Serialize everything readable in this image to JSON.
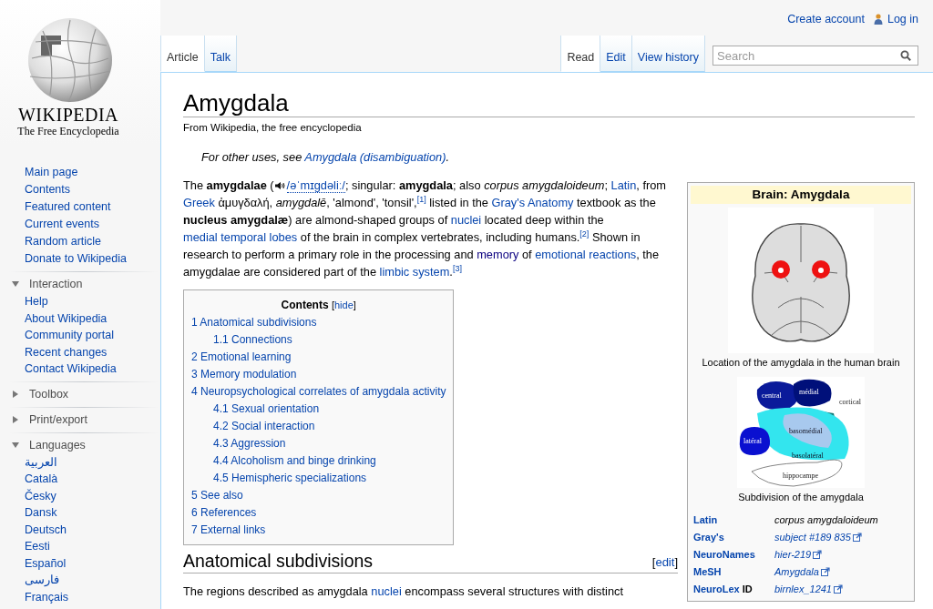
{
  "sidebar": {
    "logo": {
      "wordmark": "WIKIPEDIA",
      "tagline": "The Free Encyclopedia"
    },
    "navigation": [
      {
        "label": "Main page"
      },
      {
        "label": "Contents"
      },
      {
        "label": "Featured content"
      },
      {
        "label": "Current events"
      },
      {
        "label": "Random article"
      },
      {
        "label": "Donate to Wikipedia"
      }
    ],
    "portlets": [
      {
        "title": "Interaction",
        "expanded": true,
        "items": [
          {
            "label": "Help"
          },
          {
            "label": "About Wikipedia"
          },
          {
            "label": "Community portal"
          },
          {
            "label": "Recent changes"
          },
          {
            "label": "Contact Wikipedia"
          }
        ]
      },
      {
        "title": "Toolbox",
        "expanded": false
      },
      {
        "title": "Print/export",
        "expanded": false
      },
      {
        "title": "Languages",
        "expanded": true,
        "items": [
          {
            "label": "العربية"
          },
          {
            "label": "Català"
          },
          {
            "label": "Česky"
          },
          {
            "label": "Dansk"
          },
          {
            "label": "Deutsch"
          },
          {
            "label": "Eesti"
          },
          {
            "label": "Español"
          },
          {
            "label": "فارسی"
          },
          {
            "label": "Français"
          }
        ]
      }
    ]
  },
  "personal_tools": [
    {
      "label": "Create account",
      "icon": false
    },
    {
      "label": "Log in",
      "icon": true
    }
  ],
  "namespace_tabs": [
    {
      "label": "Article",
      "selected": true
    },
    {
      "label": "Talk",
      "selected": false
    }
  ],
  "view_tabs": [
    {
      "label": "Read",
      "selected": true
    },
    {
      "label": "Edit",
      "selected": false
    },
    {
      "label": "View history",
      "selected": false
    }
  ],
  "search": {
    "placeholder": "Search"
  },
  "article": {
    "title": "Amygdala",
    "tagline": "From Wikipedia, the free encyclopedia",
    "hatnote": [
      {
        "kind": "text",
        "text": "For other uses, see "
      },
      {
        "kind": "link",
        "text": "Amygdala (disambiguation)"
      },
      {
        "kind": "text",
        "text": "."
      }
    ],
    "intro": [
      {
        "kind": "text",
        "text": "The "
      },
      {
        "kind": "bold",
        "text": "amygdalae"
      },
      {
        "kind": "text",
        "text": " ("
      },
      {
        "kind": "audio"
      },
      {
        "kind": "ipa",
        "text": "/əˈmɪɡdəliː/"
      },
      {
        "kind": "text",
        "text": "; singular: "
      },
      {
        "kind": "bold",
        "text": "amygdala"
      },
      {
        "kind": "text",
        "text": "; also "
      },
      {
        "kind": "italic",
        "text": "corpus amygdaloideum"
      },
      {
        "kind": "text",
        "text": "; "
      },
      {
        "kind": "link",
        "text": "Latin"
      },
      {
        "kind": "text",
        "text": ", from "
      },
      {
        "kind": "link",
        "text": "Greek"
      },
      {
        "kind": "text",
        "text": " ἀμυγδαλή, "
      },
      {
        "kind": "italic",
        "text": "amygdalē"
      },
      {
        "kind": "text",
        "text": ", 'almond', 'tonsil',"
      },
      {
        "kind": "ref",
        "text": "[1]"
      },
      {
        "kind": "text",
        "text": " listed in the "
      },
      {
        "kind": "link",
        "text": "Gray's Anatomy"
      },
      {
        "kind": "text",
        "text": " textbook as the "
      },
      {
        "kind": "bold",
        "text": "nucleus amygdalæ"
      },
      {
        "kind": "text",
        "text": ") are almond-shaped groups of "
      },
      {
        "kind": "link",
        "text": "nuclei"
      },
      {
        "kind": "text",
        "text": " located deep within the "
      },
      {
        "kind": "link",
        "text": "medial temporal lobes"
      },
      {
        "kind": "text",
        "text": " of the brain in complex vertebrates, including humans."
      },
      {
        "kind": "ref",
        "text": "[2]"
      },
      {
        "kind": "text",
        "text": " Shown in research to perform a primary role in the processing and "
      },
      {
        "kind": "visited",
        "text": "memory"
      },
      {
        "kind": "text",
        "text": " of "
      },
      {
        "kind": "link",
        "text": "emotional reactions"
      },
      {
        "kind": "text",
        "text": ", the amygdalae are considered part of the "
      },
      {
        "kind": "link",
        "text": "limbic system"
      },
      {
        "kind": "text",
        "text": "."
      },
      {
        "kind": "ref",
        "text": "[3]"
      }
    ],
    "toc": {
      "title": "Contents",
      "bracket_open": "[",
      "toggle": "hide",
      "bracket_close": "]",
      "items": [
        {
          "number": "1",
          "label": "Anatomical subdivisions",
          "children": [
            {
              "number": "1.1",
              "label": "Connections"
            }
          ]
        },
        {
          "number": "2",
          "label": "Emotional learning"
        },
        {
          "number": "3",
          "label": "Memory modulation"
        },
        {
          "number": "4",
          "label": "Neuropsychological correlates of amygdala activity",
          "children": [
            {
              "number": "4.1",
              "label": "Sexual orientation"
            },
            {
              "number": "4.2",
              "label": "Social interaction"
            },
            {
              "number": "4.3",
              "label": "Aggression"
            },
            {
              "number": "4.4",
              "label": "Alcoholism and binge drinking"
            },
            {
              "number": "4.5",
              "label": "Hemispheric specializations"
            }
          ]
        },
        {
          "number": "5",
          "label": "See also"
        },
        {
          "number": "6",
          "label": "References"
        },
        {
          "number": "7",
          "label": "External links"
        }
      ]
    },
    "section": {
      "heading": "Anatomical subdivisions",
      "bracket_open": "[",
      "edit": "edit",
      "bracket_close": "]",
      "paragraph": [
        {
          "kind": "text",
          "text": "The regions described as amygdala "
        },
        {
          "kind": "link",
          "text": "nuclei"
        },
        {
          "kind": "text",
          "text": " encompass several structures with distinct"
        }
      ]
    }
  },
  "infobox": {
    "title": "Brain: Amygdala",
    "image_caption": "Location of the amygdala in the human brain",
    "diagram_labels": [
      "central",
      "médial",
      "cortical",
      "basomédial",
      "latéral",
      "basolatéral",
      "hippocampe"
    ],
    "diagram_caption": "Subdivision of the amygdala",
    "rows": [
      {
        "label": "Latin",
        "value": "corpus amygdaloideum",
        "link": false
      },
      {
        "label": "Gray's",
        "value": "subject #189 835",
        "link": true
      },
      {
        "label": "NeuroNames",
        "value": "hier-219",
        "link": true
      },
      {
        "label": "MeSH",
        "value": "Amygdala",
        "link": true
      },
      {
        "label": "NeuroLex",
        "label_suffix": " ID",
        "value": "birnlex_1241",
        "link": true
      }
    ]
  }
}
